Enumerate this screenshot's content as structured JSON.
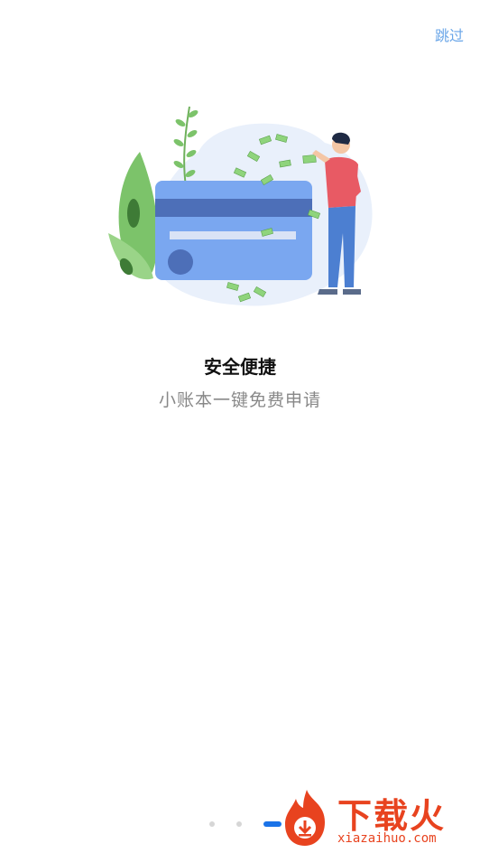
{
  "header": {
    "skip_label": "跳过"
  },
  "slide": {
    "title": "安全便捷",
    "subtitle": "小账本一键免费申请",
    "illustration": "credit-card-person-money-illustration"
  },
  "pager": {
    "total": 3,
    "active_index": 2
  },
  "watermark": {
    "brand": "下载火",
    "url": "xiazaihuo.com"
  },
  "colors": {
    "accent": "#1a73e8",
    "skip": "#6aa6e8",
    "card": "#7aa7f0",
    "watermark": "#e8431f"
  }
}
